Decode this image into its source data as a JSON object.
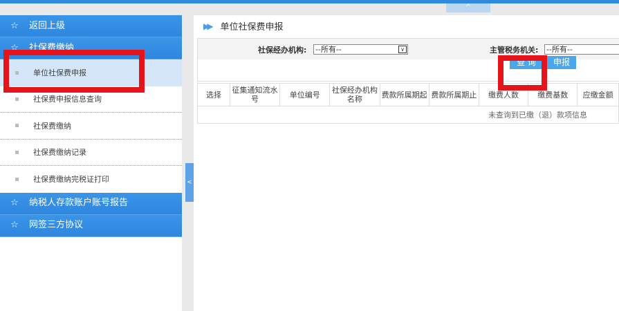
{
  "sidebar": {
    "back": "返回上级",
    "group": "社保费缴纳",
    "subitems": [
      "单位社保费申报",
      "社保费申报信息查询",
      "社保费缴纳",
      "社保费缴纳记录",
      "社保费缴纳完税证打印"
    ],
    "others": [
      "纳税人存款账户账号报告",
      "网签三方协议"
    ]
  },
  "main": {
    "title": "单位社保费申报",
    "filters": {
      "agency_label": "社保经办机构:",
      "agency_value": "--所有--",
      "tax_label": "主管税务机关:",
      "tax_value": "--所有--"
    },
    "buttons": {
      "query": "查 询",
      "declare": "申报"
    },
    "table": {
      "headers": [
        "选择",
        "征集通知流水号",
        "单位编号",
        "社保经办机构名称",
        "费款所属期起",
        "费款所属期止",
        "缴费人数",
        "缴费基数",
        "应缴金额"
      ],
      "empty": "未查询到已缴（退）款项信息"
    }
  },
  "icons": {
    "up": "^",
    "collapse": "<"
  }
}
